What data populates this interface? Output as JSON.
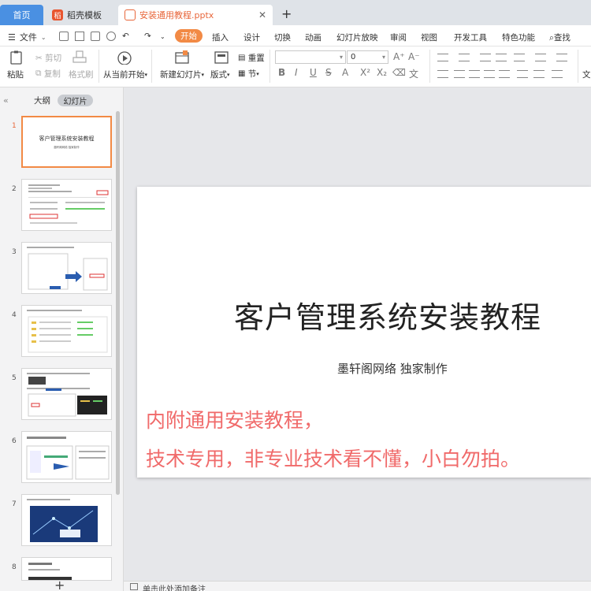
{
  "tabs": {
    "home": "首页",
    "templates": "稻壳模板",
    "document": "安装通用教程.pptx",
    "close": "✕",
    "add": "+"
  },
  "menu": {
    "file": "文件",
    "items": [
      "开始",
      "插入",
      "设计",
      "切换",
      "动画",
      "幻灯片放映",
      "审阅",
      "视图",
      "开发工具",
      "特色功能"
    ],
    "search": "查找"
  },
  "ribbon": {
    "paste": "粘贴",
    "cut": "剪切",
    "copy": "复制",
    "format_painter": "格式刷",
    "play_from_current": "从当前开始",
    "new_slide": "新建幻灯片",
    "layout": "版式",
    "reset": "重置",
    "section": "节",
    "font_name": "",
    "font_size": "0",
    "text_tool": "文"
  },
  "panel": {
    "outline_tab": "大纲",
    "slides_tab": "幻灯片",
    "thumbs": [
      {
        "num": "1",
        "title": "客户管理系统安装教程",
        "sub": "墨轩阁网络 独家制作"
      },
      {
        "num": "2"
      },
      {
        "num": "3"
      },
      {
        "num": "4"
      },
      {
        "num": "5"
      },
      {
        "num": "6"
      },
      {
        "num": "7"
      },
      {
        "num": "8"
      }
    ]
  },
  "slide": {
    "title": "客户管理系统安装教程",
    "subtitle": "墨轩阁网络 独家制作",
    "note_line1": "内附通用安装教程，",
    "note_line2": "技术专用，非专业技术看不懂，小白勿拍。"
  },
  "notes": {
    "placeholder": "单击此处添加备注"
  },
  "colors": {
    "accent": "#f28a45",
    "home_tab": "#4a90e2",
    "red_text": "#f06a6a"
  }
}
